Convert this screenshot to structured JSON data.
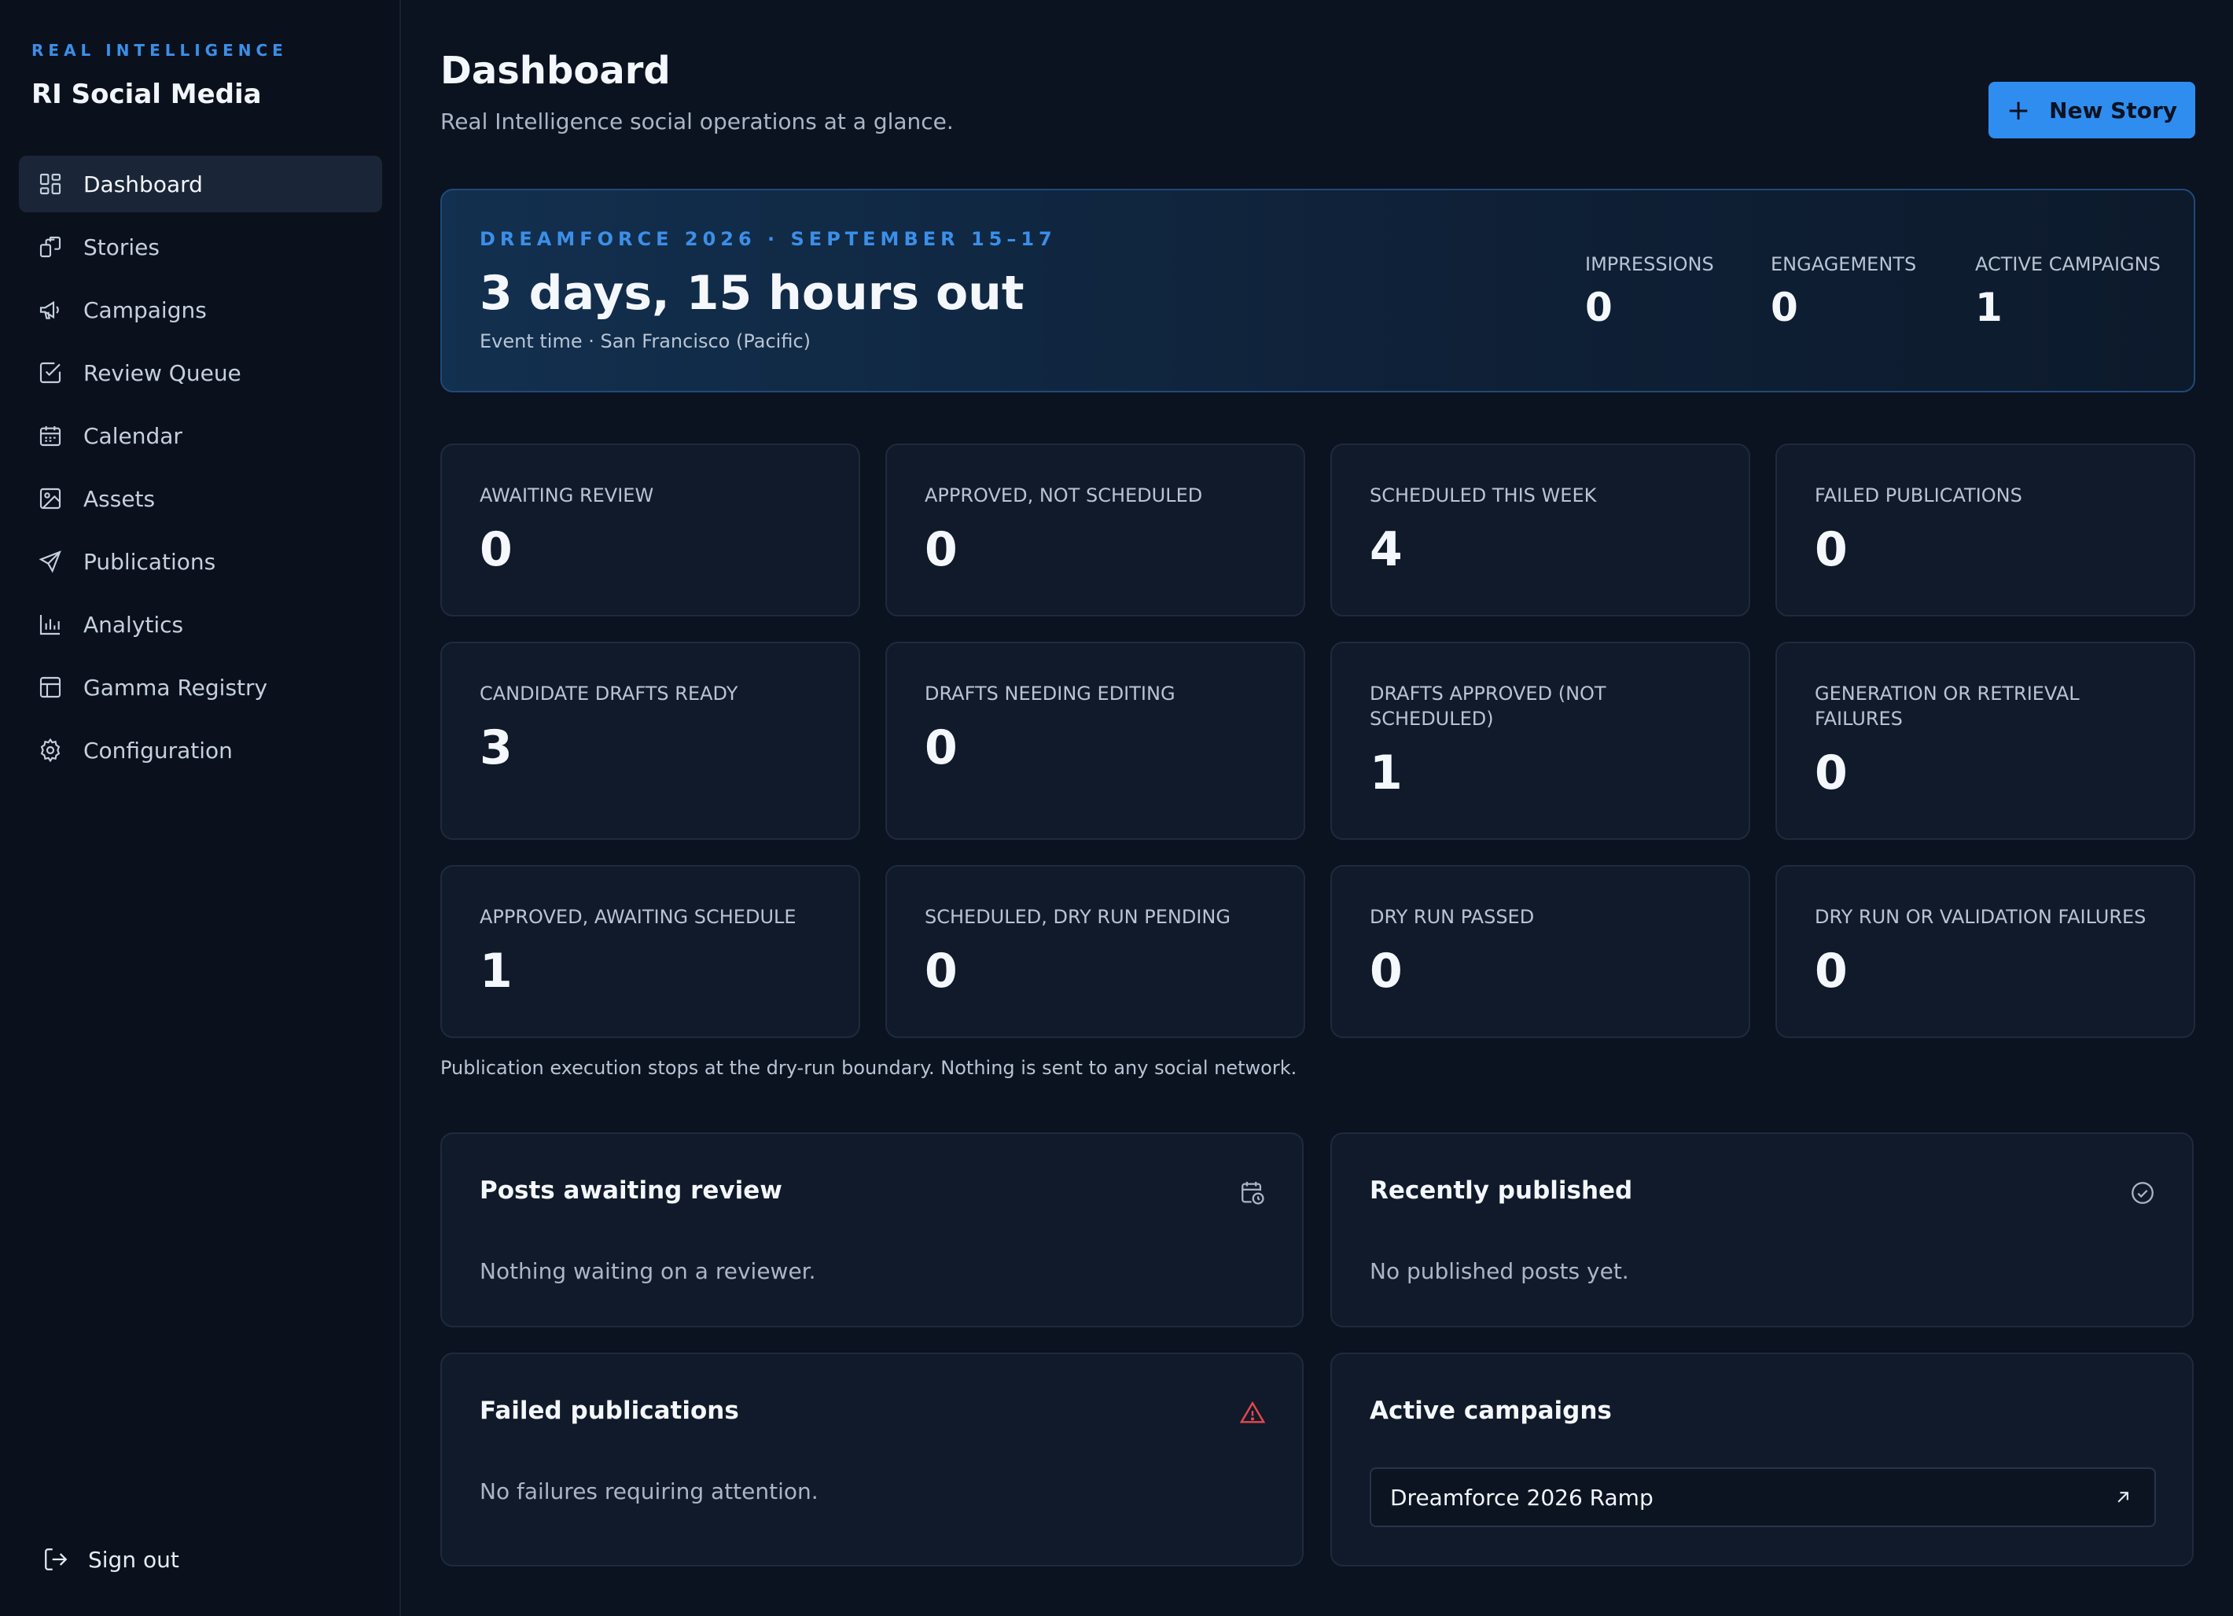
{
  "brand": {
    "kicker": "REAL INTELLIGENCE",
    "title": "RI Social Media"
  },
  "nav": {
    "items": [
      {
        "label": "Dashboard",
        "icon": "dashboard-icon",
        "active": true
      },
      {
        "label": "Stories",
        "icon": "stories-icon"
      },
      {
        "label": "Campaigns",
        "icon": "megaphone-icon"
      },
      {
        "label": "Review Queue",
        "icon": "checkbox-icon"
      },
      {
        "label": "Calendar",
        "icon": "calendar-icon"
      },
      {
        "label": "Assets",
        "icon": "image-icon"
      },
      {
        "label": "Publications",
        "icon": "send-icon"
      },
      {
        "label": "Analytics",
        "icon": "bar-chart-icon"
      },
      {
        "label": "Gamma Registry",
        "icon": "table-icon"
      },
      {
        "label": "Configuration",
        "icon": "gear-icon"
      }
    ],
    "signout": "Sign out"
  },
  "header": {
    "title": "Dashboard",
    "subtitle": "Real Intelligence social operations at a glance.",
    "new_story": "New Story"
  },
  "hero": {
    "kicker": "DREAMFORCE 2026 · SEPTEMBER 15–17",
    "countdown": "3 days, 15 hours out",
    "note": "Event time · San Francisco (Pacific)",
    "stats": [
      {
        "label": "IMPRESSIONS",
        "value": "0"
      },
      {
        "label": "ENGAGEMENTS",
        "value": "0"
      },
      {
        "label": "ACTIVE CAMPAIGNS",
        "value": "1"
      }
    ]
  },
  "metrics": [
    {
      "label": "Awaiting review",
      "value": "0"
    },
    {
      "label": "Approved, not scheduled",
      "value": "0"
    },
    {
      "label": "Scheduled this week",
      "value": "4"
    },
    {
      "label": "Failed publications",
      "value": "0"
    },
    {
      "label": "Candidate drafts ready",
      "value": "3"
    },
    {
      "label": "Drafts needing editing",
      "value": "0"
    },
    {
      "label": "Drafts approved (not scheduled)",
      "value": "1"
    },
    {
      "label": "Generation or retrieval failures",
      "value": "0"
    },
    {
      "label": "Approved, awaiting schedule",
      "value": "1"
    },
    {
      "label": "Scheduled, dry run pending",
      "value": "0"
    },
    {
      "label": "Dry run passed",
      "value": "0"
    },
    {
      "label": "Dry run or validation failures",
      "value": "0"
    }
  ],
  "footnote": "Publication execution stops at the dry-run boundary. Nothing is sent to any social network.",
  "panels": {
    "awaiting": {
      "title": "Posts awaiting review",
      "body": "Nothing waiting on a reviewer.",
      "icon": "calendar-clock-icon"
    },
    "published": {
      "title": "Recently published",
      "body": "No published posts yet.",
      "icon": "check-circle-icon"
    },
    "failed": {
      "title": "Failed publications",
      "body": "No failures requiring attention.",
      "icon": "warning-icon"
    },
    "campaigns": {
      "title": "Active campaigns",
      "items": [
        {
          "label": "Dreamforce 2026 Ramp"
        }
      ]
    }
  },
  "colors": {
    "accent": "#2f8df0",
    "background": "#0b1220",
    "card": "#111a2a",
    "danger": "#e5484d"
  }
}
